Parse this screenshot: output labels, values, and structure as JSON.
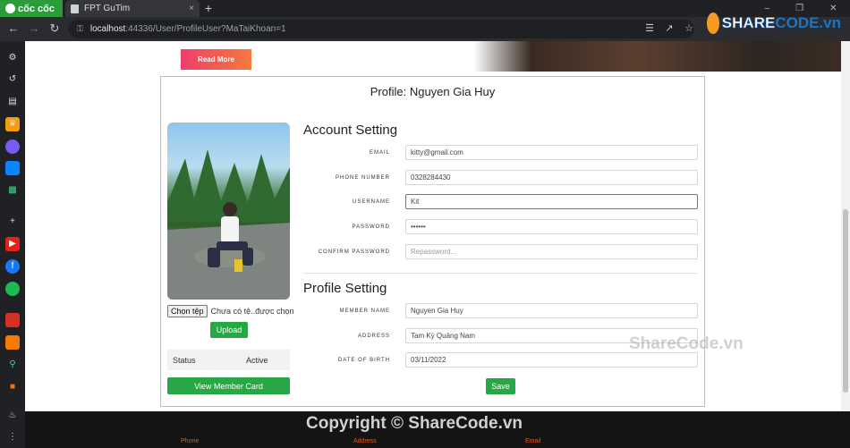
{
  "browser": {
    "brand_label": "cốc cốc",
    "tab_title": "FPT GuTim",
    "tab_close": "×",
    "new_tab": "+",
    "url_host": "localhost",
    "url_rest": ":44336/User/ProfileUser?MaTaiKhoan=1"
  },
  "hero": {
    "read_more": "Read More"
  },
  "profile": {
    "title": "Profile: Nguyen Gia Huy",
    "file_button": "Chọn tệp",
    "file_status": "Chưa có tệ..được chọn",
    "upload": "Upload",
    "status_label": "Status",
    "status_value": "Active",
    "view_member_card": "View Member Card"
  },
  "account_setting": {
    "heading": "Account Setting",
    "email_label": "EMAIL",
    "email_value": "kitty@gmail.com",
    "phone_label": "PHONE NUMBER",
    "phone_value": "0328284430",
    "username_label": "USERNAME",
    "username_value": "Kit",
    "password_label": "PASSWORD",
    "password_value": "••••••",
    "confirm_label": "CONFIRM PASSWORD",
    "confirm_placeholder": "Repassword..."
  },
  "profile_setting": {
    "heading": "Profile Setting",
    "member_name_label": "MEMBER NAME",
    "member_name_value": "Nguyen Gia Huy",
    "address_label": "ADDRESS",
    "address_value": "Tam Kỳ Quảng Nam",
    "dob_label": "DATE OF BIRTH",
    "dob_value": "03/11/2022",
    "save": "Save"
  },
  "footer": {
    "phone": "Phone",
    "address": "Address",
    "email": "Email"
  },
  "watermarks": {
    "copyright": "Copyright © ShareCode.vn",
    "middle": "ShareCode.vn",
    "logo_share": "SHARE",
    "logo_code": "CODE.vn"
  },
  "colors": {
    "green_button": "#28a745",
    "read_more_start": "#ef3d6b",
    "read_more_end": "#f5793b",
    "footer_link": "#e05a2b"
  }
}
